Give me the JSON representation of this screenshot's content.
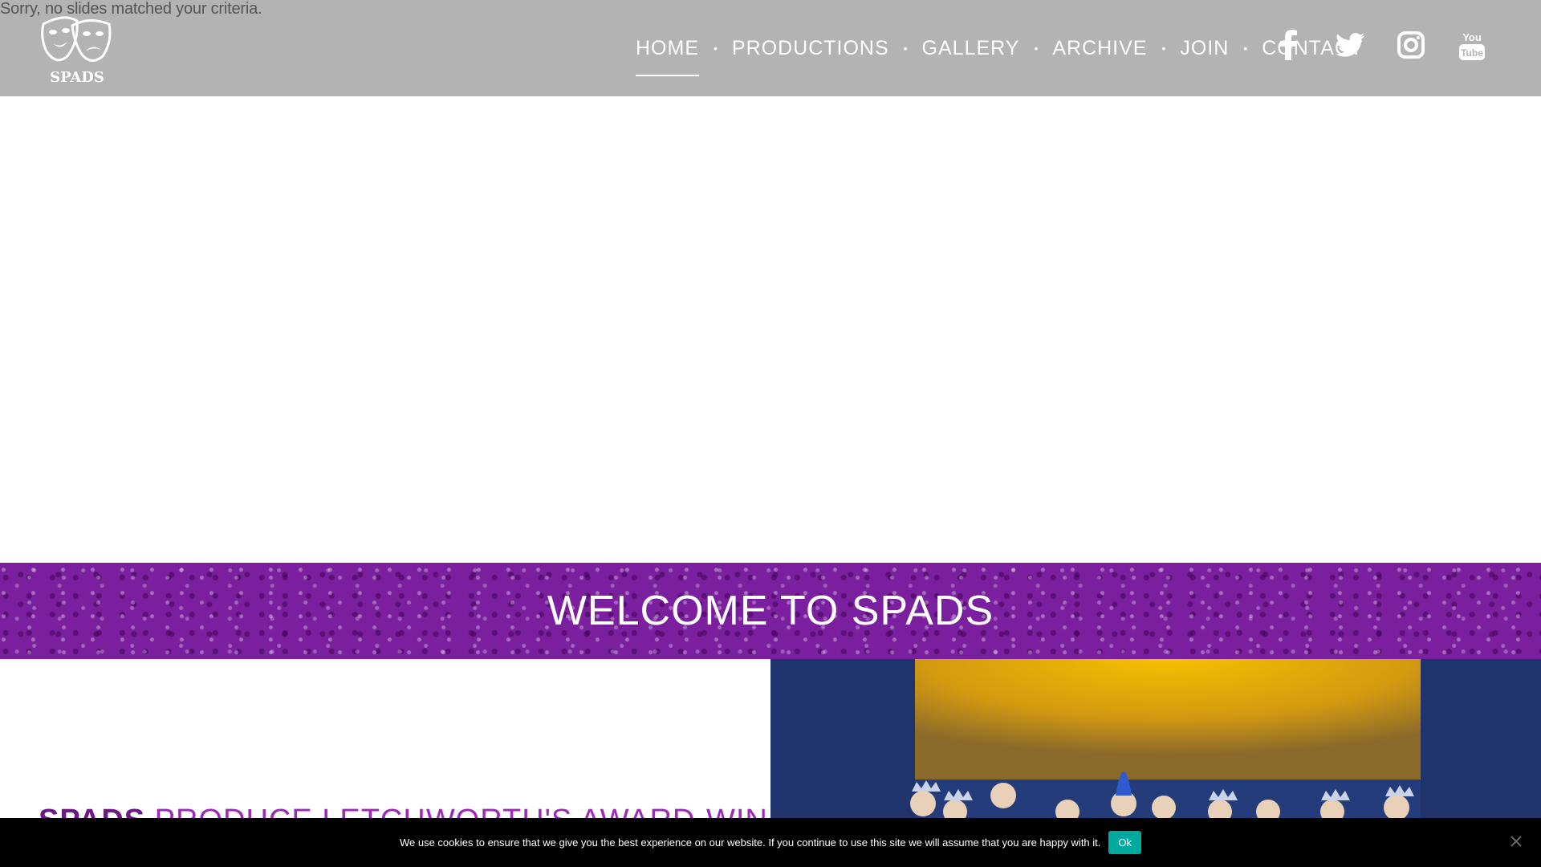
{
  "slider": {
    "message": "Sorry, no slides matched your criteria."
  },
  "header": {
    "logo_text": "SPADS",
    "nav": [
      {
        "label": "HOME",
        "active": true
      },
      {
        "label": "PRODUCTIONS"
      },
      {
        "label": "GALLERY"
      },
      {
        "label": "ARCHIVE"
      },
      {
        "label": "JOIN"
      },
      {
        "label": "CONTACT"
      }
    ],
    "separator": "•",
    "social": [
      "facebook-icon",
      "twitter-icon",
      "instagram-icon",
      "youtube-icon"
    ],
    "youtube_you": "You",
    "youtube_tube": "Tube"
  },
  "welcome": {
    "title": "WELCOME TO SPADS"
  },
  "intro": {
    "brand": "SPADS",
    "rest": " PRODUCE LETCHWORTH'S AWARD-WINNING"
  },
  "cookie": {
    "text": "We use cookies to ensure that we give you the best experience on our website. If you continue to use this site we will assume that you are happy with it.",
    "ok_label": "Ok"
  },
  "colors": {
    "header_bg": "#b3b3b3",
    "purple_band": "#7a1f9e",
    "headline_purple": "#9b2bb5",
    "cookie_ok": "#00a99d"
  }
}
